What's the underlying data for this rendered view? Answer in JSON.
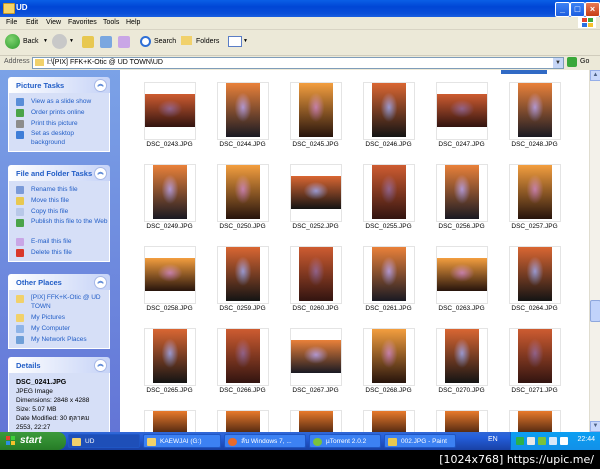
{
  "window": {
    "title": "UD"
  },
  "menu": [
    "File",
    "Edit",
    "View",
    "Favorites",
    "Tools",
    "Help"
  ],
  "toolbar": {
    "back": "Back",
    "search": "Search",
    "folders": "Folders"
  },
  "address": {
    "label": "Address",
    "path": "I:\\[PIX] FFK+K-Otic @ UD TOWN\\UD",
    "go": "Go"
  },
  "picture_tasks": {
    "title": "Picture Tasks",
    "items": [
      "View as a slide show",
      "Order prints online",
      "Print this picture",
      "Set as desktop background"
    ]
  },
  "file_tasks": {
    "title": "File and Folder Tasks",
    "items": [
      "Rename this file",
      "Move this file",
      "Copy this file",
      "Publish this file to the Web",
      "E-mail this file",
      "Delete this file"
    ]
  },
  "other_places": {
    "title": "Other Places",
    "items": [
      "[PIX] FFK+K-Otic @ UD TOWN",
      "My Pictures",
      "My Computer",
      "My Network Places"
    ]
  },
  "details": {
    "title": "Details",
    "name": "DSC_0241.JPG",
    "type": "JPEG Image",
    "dimensions": "Dimensions: 2848 x 4288",
    "size": "Size: 5.07 MB",
    "date": "Date Modified: 30 ตุลาคม 2553, 22:27"
  },
  "files": [
    [
      "DSC_0243.JPG",
      "DSC_0244.JPG",
      "DSC_0245.JPG",
      "DSC_0246.JPG",
      "DSC_0247.JPG",
      "DSC_0248.JPG"
    ],
    [
      "DSC_0249.JPG",
      "DSC_0250.JPG",
      "DSC_0252.JPG",
      "DSC_0255.JPG",
      "DSC_0256.JPG",
      "DSC_0257.JPG"
    ],
    [
      "DSC_0258.JPG",
      "DSC_0259.JPG",
      "DSC_0260.JPG",
      "DSC_0261.JPG",
      "DSC_0263.JPG",
      "DSC_0264.JPG"
    ],
    [
      "DSC_0265.JPG",
      "DSC_0266.JPG",
      "DSC_0267.JPG",
      "DSC_0268.JPG",
      "DSC_0270.JPG",
      "DSC_0271.JPG"
    ]
  ],
  "taskbar": {
    "start": "start",
    "tasks": [
      "UD",
      "KAEWJAI (G:)",
      "ลับ Windows 7, ...",
      "µTorrent 2.0.2",
      "002.JPG - Paint"
    ],
    "lang": "EN",
    "clock": "22:44"
  },
  "watermark": "[1024x768] https://upic.me/",
  "colors": {
    "titlebar": "#0046d5",
    "taskpane": "#6375d6",
    "start": "#2f8a2f"
  }
}
